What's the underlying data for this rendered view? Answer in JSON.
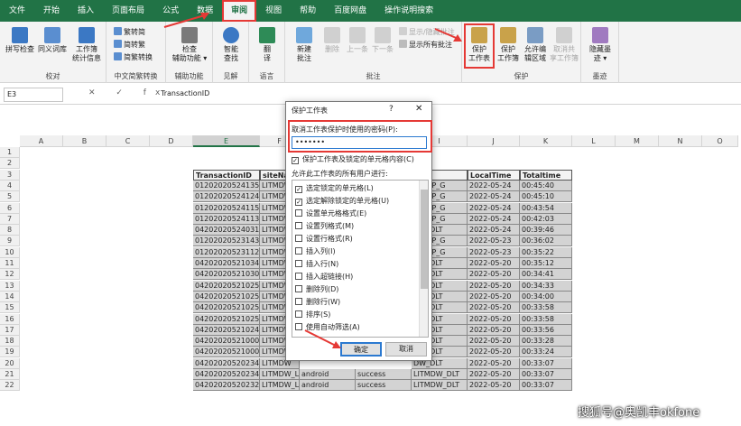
{
  "tabs": [
    "文件",
    "开始",
    "插入",
    "页面布局",
    "公式",
    "数据",
    "审阅",
    "视图",
    "帮助",
    "百度网盘",
    "操作说明搜索"
  ],
  "ribbon": {
    "groups": {
      "proofing": {
        "label": "校对",
        "spell": "拼写检查",
        "thesaurus": "同义词库",
        "stats": "工作簿\n统计信息"
      },
      "chinese": {
        "label": "中文简繁转换",
        "t2s": "繁转简",
        "s2t": "简转繁",
        "convert": "简繁转换"
      },
      "access": {
        "label": "辅助功能",
        "check": "检查\n辅助功能 ▾"
      },
      "insights": {
        "label": "见解",
        "smart": "智能\n查找"
      },
      "language": {
        "label": "语言",
        "translate": "翻\n译"
      },
      "comments": {
        "label": "批注",
        "new": "新建\n批注",
        "delete": "删除",
        "prev": "上一条",
        "next": "下一条",
        "show": "显示/隐藏批注",
        "showall": "显示所有批注"
      },
      "protect": {
        "label": "保护",
        "sheet": "保护\n工作表",
        "book": "保护\n工作簿",
        "allow": "允许编\n辑区域",
        "unshare": "取消共\n享工作簿"
      },
      "ink": {
        "label": "墨迹",
        "hide": "隐藏墨\n迹 ▾"
      }
    }
  },
  "formula_bar": {
    "name_box": "E3",
    "icons": "✕ ✓ fx",
    "content": "TransactionID"
  },
  "columns": [
    "A",
    "B",
    "C",
    "D",
    "E",
    "F",
    "G",
    "H",
    "I",
    "J",
    "K",
    "L",
    "M",
    "N",
    "O"
  ],
  "rows": [
    "1",
    "2",
    "3",
    "4",
    "5",
    "6",
    "7",
    "8",
    "9",
    "10",
    "11",
    "12",
    "13",
    "14",
    "15",
    "16",
    "17",
    "18",
    "19",
    "20",
    "21",
    "22"
  ],
  "table": {
    "headers": {
      "e": "TransactionID",
      "f": "siteNar",
      "i": "tor",
      "j": "LocalTime",
      "k": "Totaltime"
    },
    "e_values": [
      "01202020524135",
      "01202020524124",
      "01202020524115",
      "01202020524113",
      "04202020524031",
      "01202020523143",
      "01202020523112",
      "04202020521034",
      "04202020521030",
      "04202020521025",
      "04202020521025",
      "04202020521025",
      "04202020521025",
      "04202020521024",
      "04202020521000",
      "04202020521000",
      "04202020520234",
      "04202020520234",
      "04202020520232"
    ],
    "f_values": [
      "LITMDW",
      "LITMDW",
      "LITMDW",
      "LITMDW",
      "LITMDW",
      "LITMDW",
      "LITMDW",
      "LITMDW",
      "LITMDW",
      "LITMDW",
      "LITMDW",
      "LITMDW",
      "LITMDW",
      "LITMDW",
      "LITMDW",
      "LITMDW",
      "LITMDW",
      "LITMDW_L",
      "LITMDW_L"
    ],
    "i_values": [
      "DW_JP_G",
      "DW_JP_G",
      "DW_JP_G",
      "DW_JP_G",
      "DW_DLT",
      "DW_JP_G",
      "DW_JP_G",
      "DW_DLT",
      "DW_DLT",
      "DW_DLT",
      "DW_DLT",
      "DW_DLT",
      "DW_DLT",
      "DW_DLT",
      "DW_DLT",
      "DW_DLT",
      "DW_DLT",
      "LITMDW_DLT",
      "LITMDW_DLT"
    ],
    "j_values": [
      "2022-05-24",
      "2022-05-24",
      "2022-05-24",
      "2022-05-24",
      "2022-05-24",
      "2022-05-23",
      "2022-05-23",
      "2022-05-20",
      "2022-05-20",
      "2022-05-20",
      "2022-05-20",
      "2022-05-20",
      "2022-05-20",
      "2022-05-20",
      "2022-05-20",
      "2022-05-20",
      "2022-05-20",
      "2022-05-20",
      "2022-05-20"
    ],
    "k_values": [
      "00:45:40",
      "00:45:10",
      "00:43:54",
      "00:42:03",
      "00:39:46",
      "00:36:02",
      "00:35:22",
      "00:35:12",
      "00:34:41",
      "00:34:33",
      "00:34:00",
      "00:33:58",
      "00:33:58",
      "00:33:56",
      "00:33:28",
      "00:33:24",
      "00:33:07",
      "00:33:07",
      "00:33:07"
    ],
    "g_extra": [
      "android",
      "android"
    ],
    "h_extra": [
      "success",
      "success"
    ]
  },
  "dialog": {
    "title": "保护工作表",
    "help": "?",
    "close": "✕",
    "pw_label": "取消工作表保护时使用的密码(P):",
    "pw_value": "•••••••",
    "protect_check": "保护工作表及锁定的单元格内容(C)",
    "allow_label": "允许此工作表的所有用户进行:",
    "permissions": [
      {
        "label": "选定锁定的单元格(L)",
        "checked": true
      },
      {
        "label": "选定解除锁定的单元格(U)",
        "checked": true
      },
      {
        "label": "设置单元格格式(E)",
        "checked": false
      },
      {
        "label": "设置列格式(M)",
        "checked": false
      },
      {
        "label": "设置行格式(R)",
        "checked": false
      },
      {
        "label": "插入列(I)",
        "checked": false
      },
      {
        "label": "插入行(N)",
        "checked": false
      },
      {
        "label": "插入超链接(H)",
        "checked": false
      },
      {
        "label": "删除列(D)",
        "checked": false
      },
      {
        "label": "删除行(W)",
        "checked": false
      },
      {
        "label": "排序(S)",
        "checked": false
      },
      {
        "label": "使用自动筛选(A)",
        "checked": false
      }
    ],
    "ok": "确定",
    "cancel": "取消"
  },
  "watermark": "搜狐号@奥凯丰okfone",
  "colors": {
    "excel_green": "#217346",
    "highlight_red": "#e53935",
    "accent_blue": "#2b79d0"
  }
}
